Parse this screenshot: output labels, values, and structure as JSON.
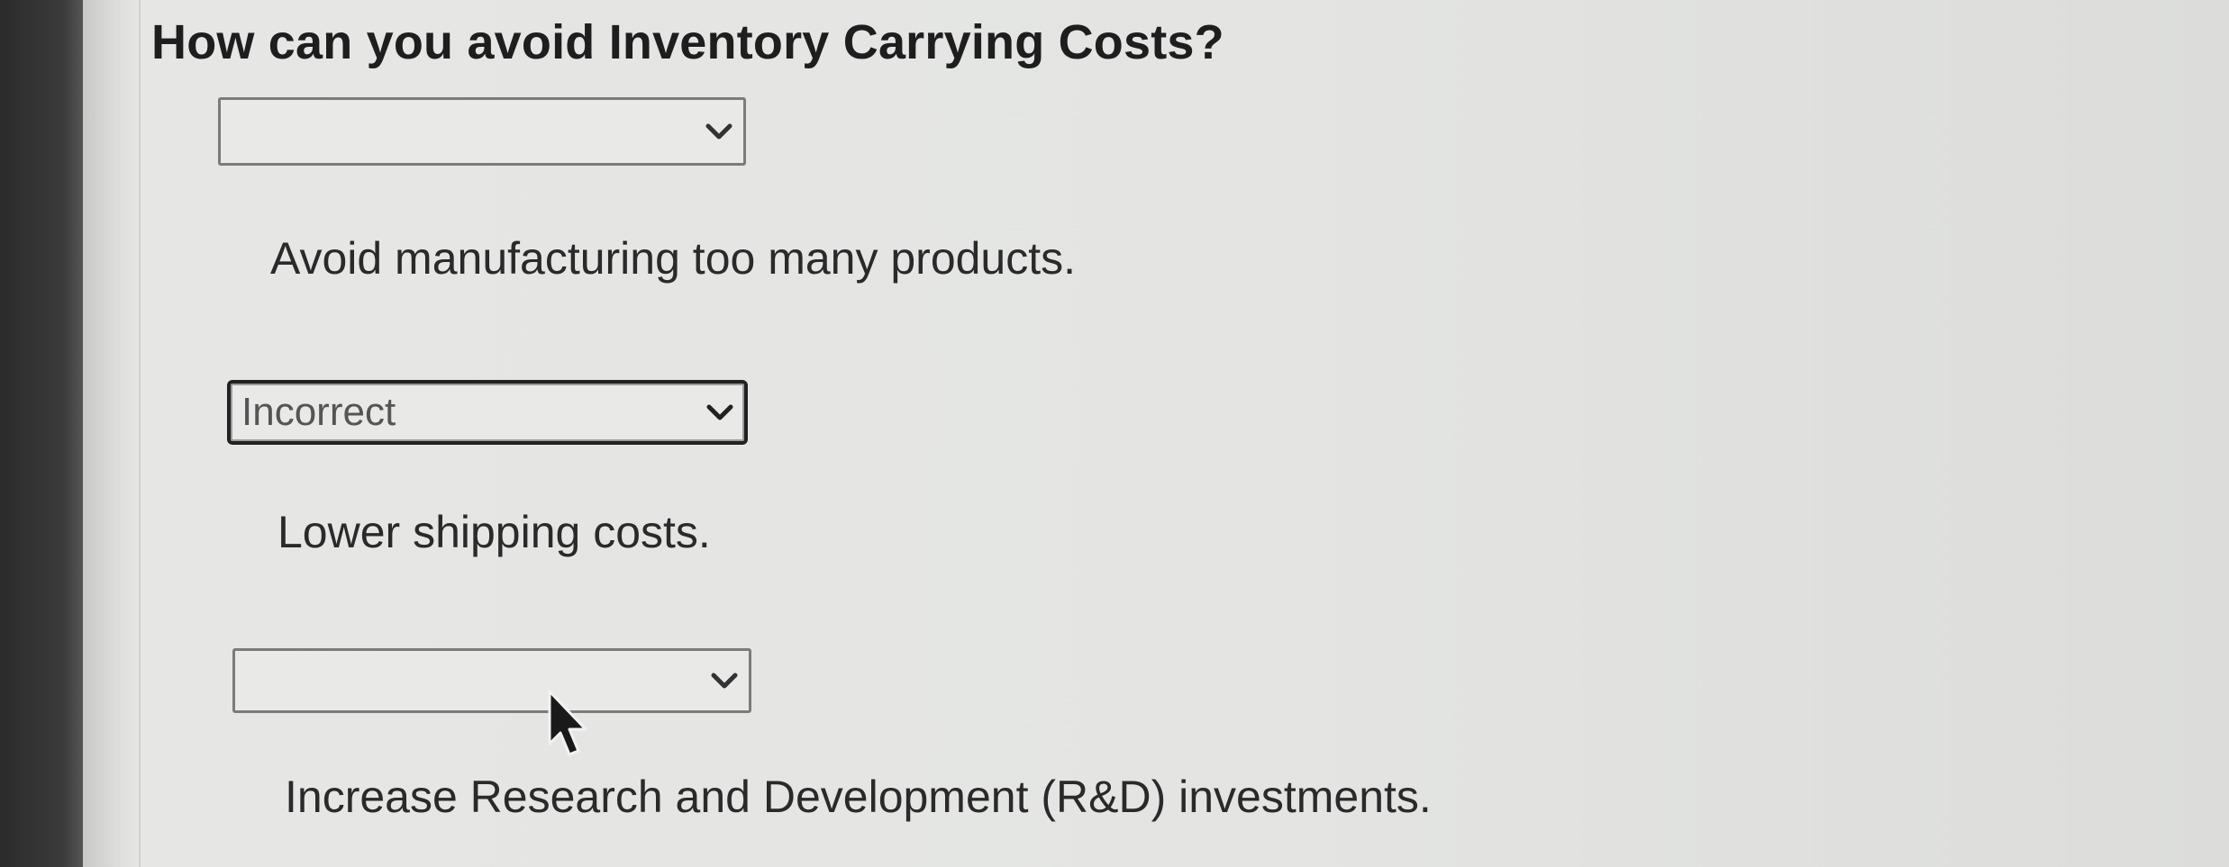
{
  "question": "How can you avoid Inventory Carrying Costs?",
  "items": [
    {
      "select_value": "",
      "answer_text": "Avoid manufacturing too many products."
    },
    {
      "select_value": "Incorrect",
      "answer_text": "Lower shipping costs."
    },
    {
      "select_value": "",
      "answer_text": "Increase Research and Development (R&D) investments."
    }
  ],
  "icons": {
    "dropdown": "chevron-down-icon",
    "cursor": "mouse-pointer-icon"
  },
  "colors": {
    "text": "#1e1e1e",
    "background": "#e4e5e3",
    "incorrect_border": "#222222"
  }
}
